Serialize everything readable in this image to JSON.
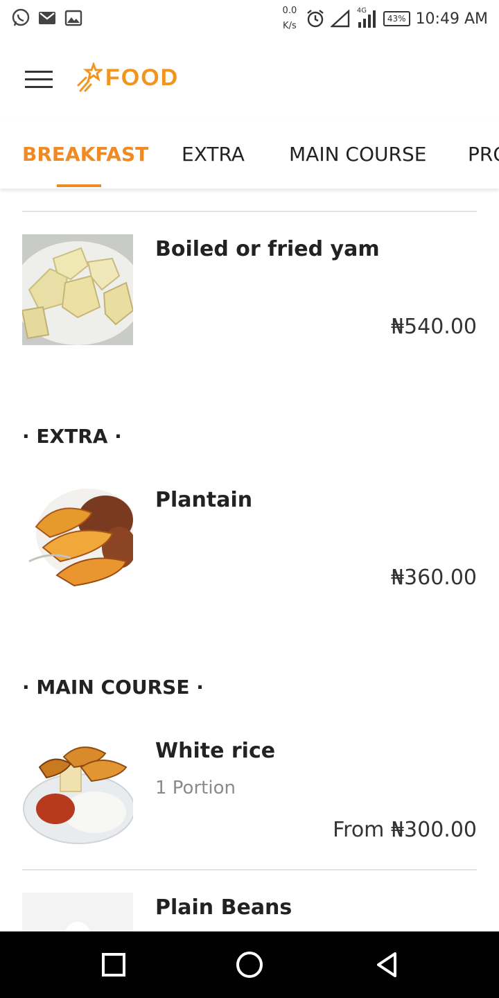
{
  "status_bar": {
    "net_speed_value": "0.0",
    "net_speed_unit": "K/s",
    "network": "4G",
    "battery": "43%",
    "time": "10:49 AM"
  },
  "app_bar": {
    "logo_text": "FOOD",
    "brand_color": "#f2951f"
  },
  "tabs": [
    {
      "label": "BREAKFAST",
      "active": true
    },
    {
      "label": "EXTRA",
      "active": false
    },
    {
      "label": "MAIN COURSE",
      "active": false
    },
    {
      "label": "PRO",
      "active": false
    }
  ],
  "sections": [
    {
      "title": "",
      "items": [
        {
          "name": "Boiled or fried yam",
          "portion": "",
          "price": "₦540.00"
        }
      ]
    },
    {
      "title": "· EXTRA ·",
      "items": [
        {
          "name": "Plantain",
          "portion": "",
          "price": "₦360.00"
        }
      ]
    },
    {
      "title": "· MAIN COURSE ·",
      "items": [
        {
          "name": "White rice",
          "portion": "1 Portion",
          "price": "From ₦300.00"
        },
        {
          "name": "Plain Beans",
          "portion": "",
          "price": ""
        }
      ]
    }
  ],
  "nav": {
    "icons": [
      "recent-apps-icon",
      "home-icon",
      "back-icon"
    ]
  }
}
